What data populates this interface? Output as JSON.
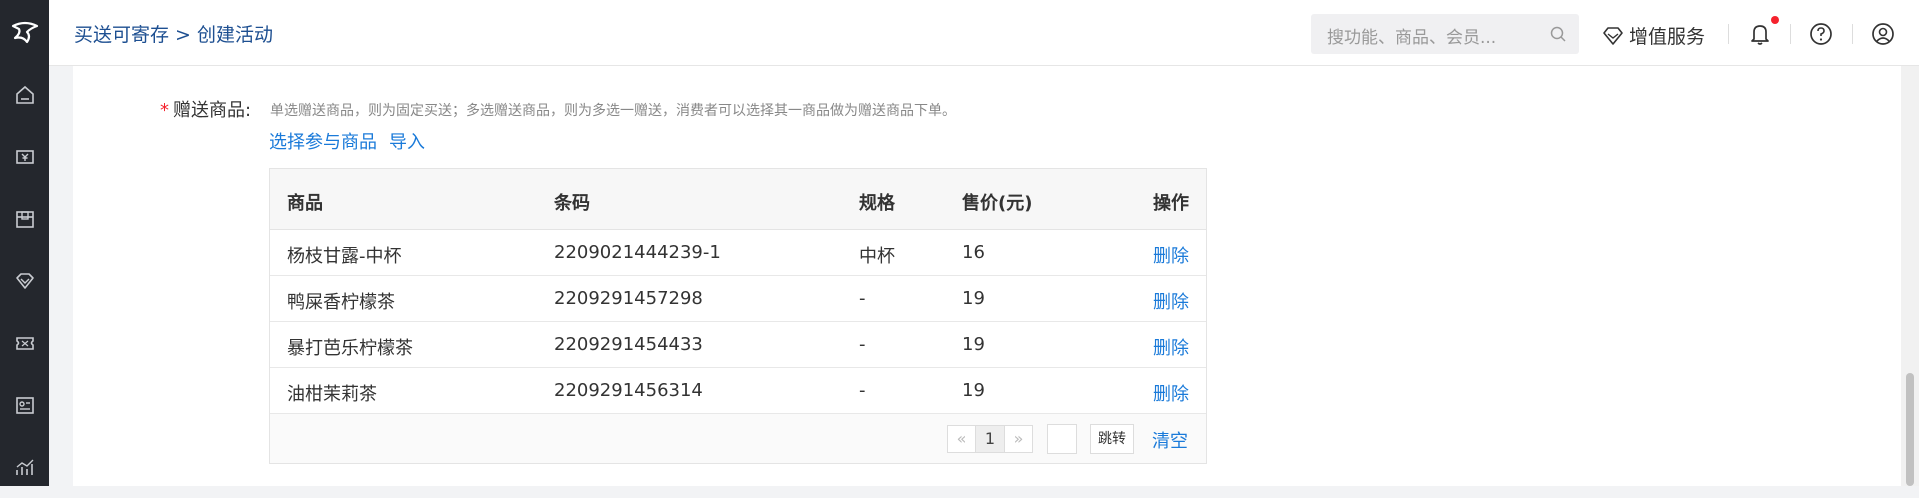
{
  "header": {
    "breadcrumb": "买送可寄存 > 创建活动",
    "search_placeholder": "搜功能、商品、会员...",
    "value_added": "增值服务"
  },
  "sidebar": {
    "icons": [
      "home-icon",
      "cashier-icon",
      "box-icon",
      "diamond-icon",
      "coupon-icon",
      "member-card-icon",
      "chart-icon"
    ]
  },
  "form": {
    "label": "赠送商品:",
    "required_mark": "*",
    "hint": "单选赠送商品，则为固定买送；多选赠送商品，则为多选一赠送，消费者可以选择其一商品做为赠送商品下单。",
    "select_link": "选择参与商品",
    "import_link": "导入"
  },
  "table": {
    "columns": [
      "商品",
      "条码",
      "规格",
      "售价(元)",
      "操作"
    ],
    "rows": [
      {
        "name": "杨枝甘露-中杯",
        "barcode": "2209021444239-1",
        "spec": "中杯",
        "price": "16",
        "action": "删除"
      },
      {
        "name": "鸭屎香柠檬茶",
        "barcode": "2209291457298",
        "spec": "-",
        "price": "19",
        "action": "删除"
      },
      {
        "name": "暴打芭乐柠檬茶",
        "barcode": "2209291454433",
        "spec": "-",
        "price": "19",
        "action": "删除"
      },
      {
        "name": "油柑茉莉茶",
        "barcode": "2209291456314",
        "spec": "-",
        "price": "19",
        "action": "删除"
      }
    ]
  },
  "pager": {
    "prev": "«",
    "current": "1",
    "next": "»",
    "jump": "跳转",
    "clear": "清空"
  },
  "colors": {
    "sidebar_bg": "#24272d",
    "link": "#1a7ad9",
    "breadcrumb": "#1d4f91",
    "required": "#f5222d"
  }
}
